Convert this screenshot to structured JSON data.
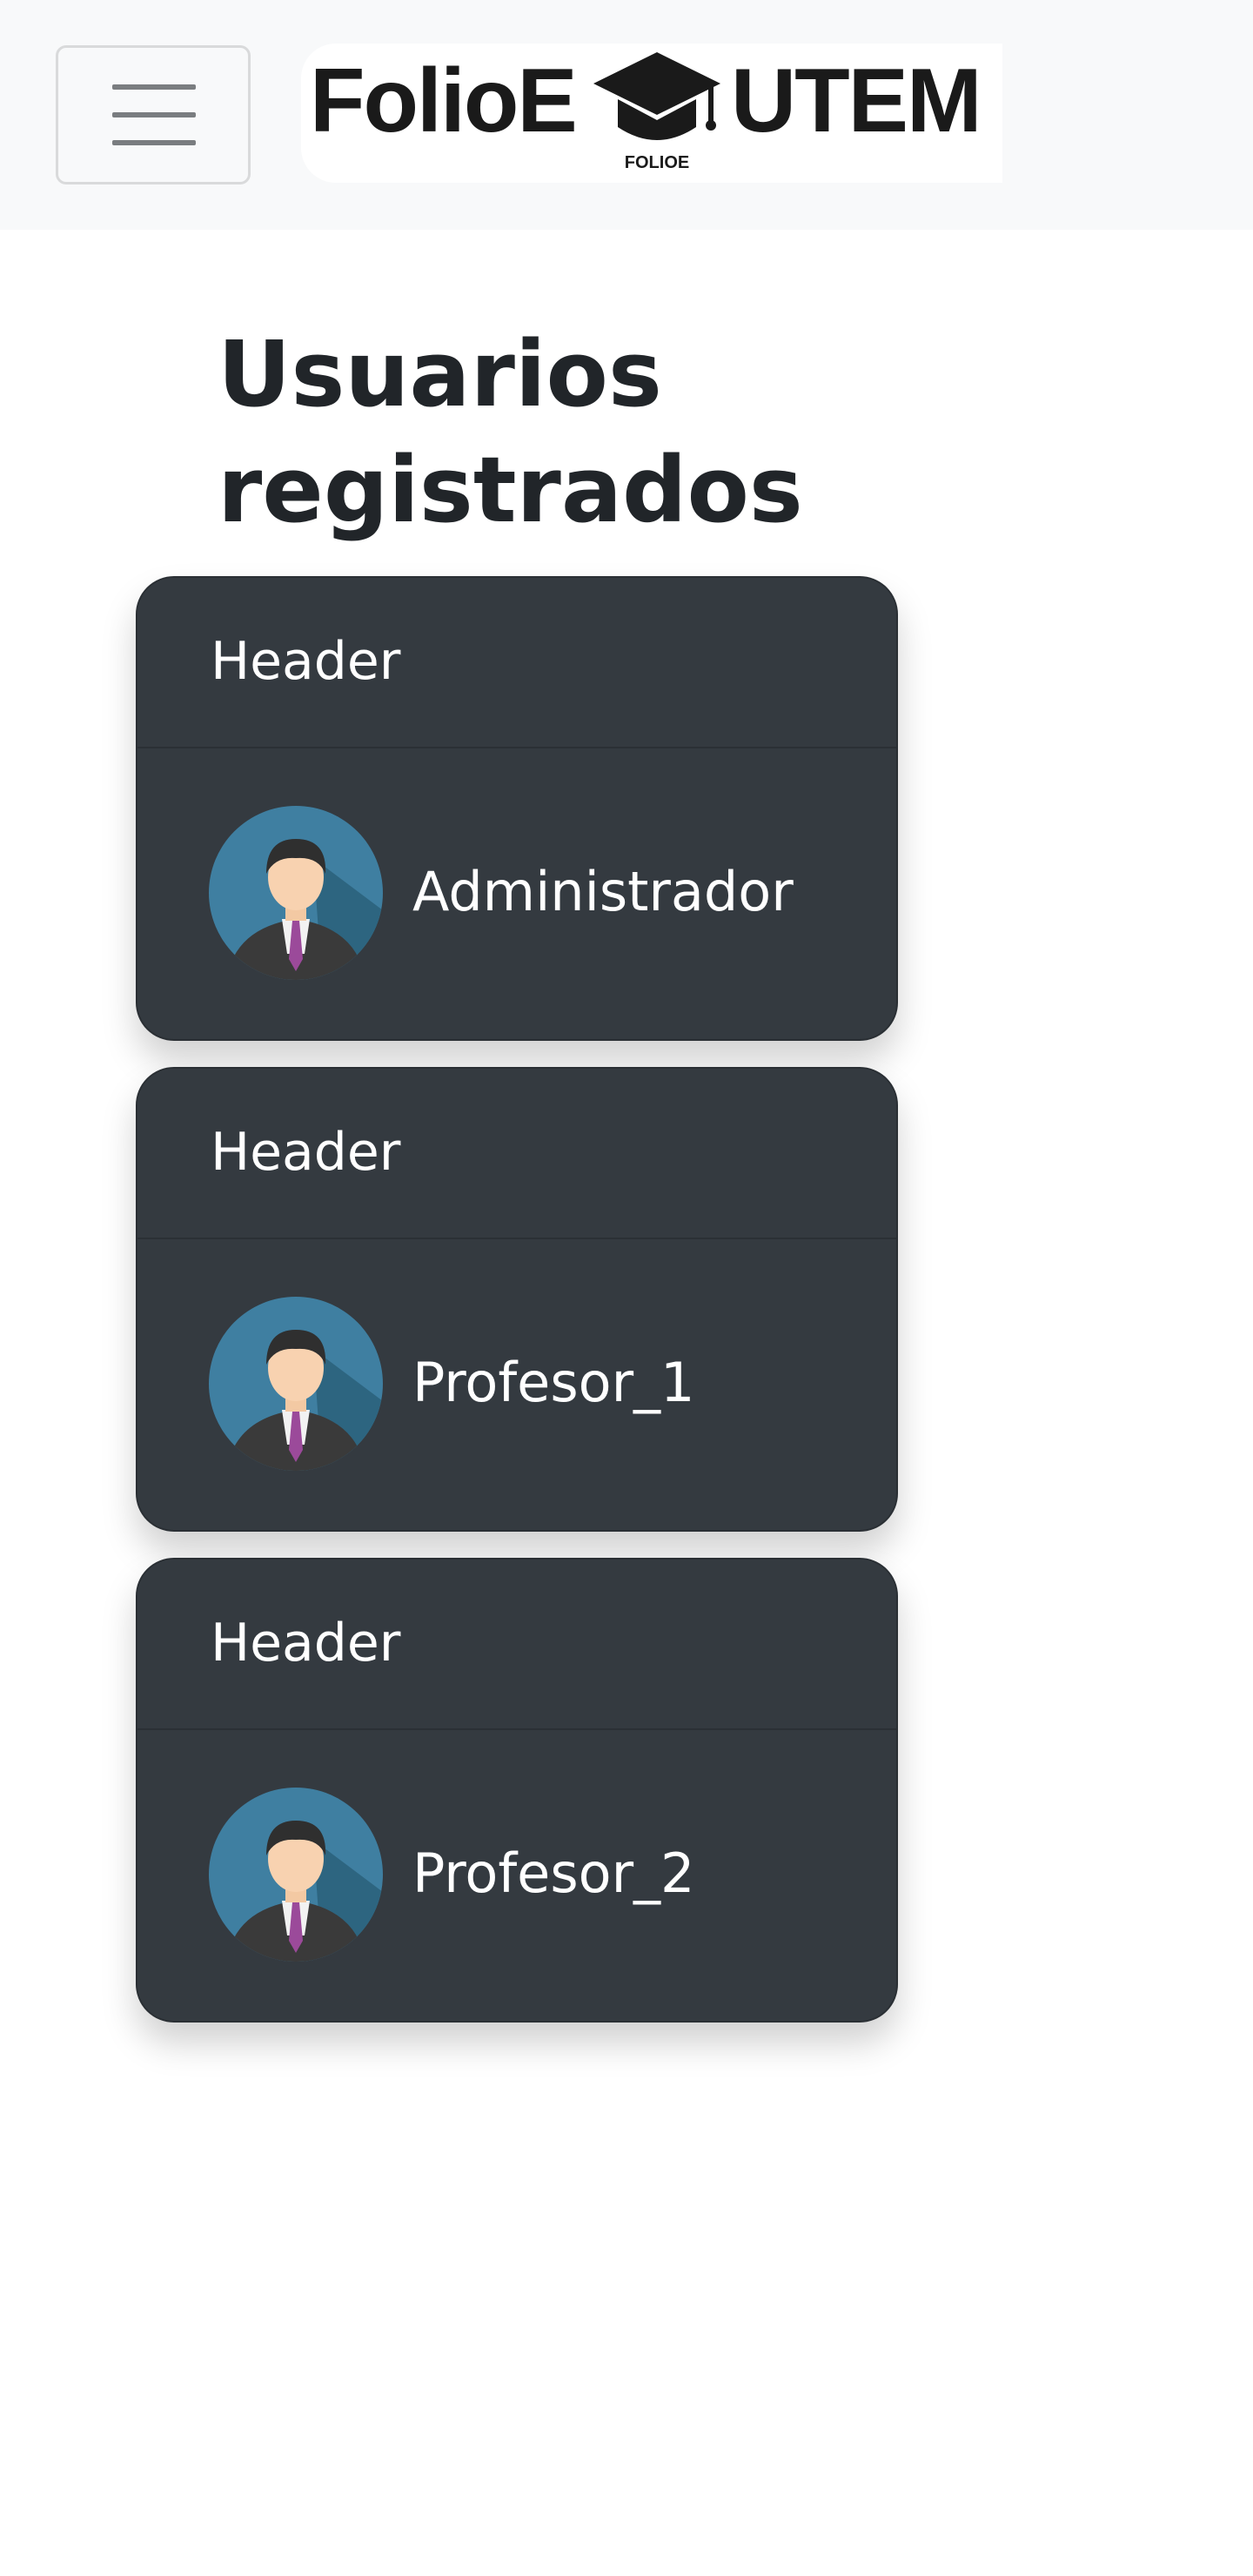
{
  "navbar": {
    "toggler_icon": "hamburger-menu-icon",
    "brand": {
      "word_left": "FolioE",
      "word_right": "UTEM",
      "cap_label": "FOLIOE",
      "cap_icon": "graduation-cap-icon"
    }
  },
  "main": {
    "title": "Usuarios registrados",
    "cards": [
      {
        "header": "Header",
        "name": "Administrador",
        "avatar_icon": "user-avatar-icon"
      },
      {
        "header": "Header",
        "name": "Profesor_1",
        "avatar_icon": "user-avatar-icon"
      },
      {
        "header": "Header",
        "name": "Profesor_2",
        "avatar_icon": "user-avatar-icon"
      }
    ]
  },
  "colors": {
    "navbar_bg": "#f8f9fa",
    "card_bg": "#343a40",
    "avatar_circle": "#3f7fa1",
    "tie": "#9b4a9a"
  }
}
